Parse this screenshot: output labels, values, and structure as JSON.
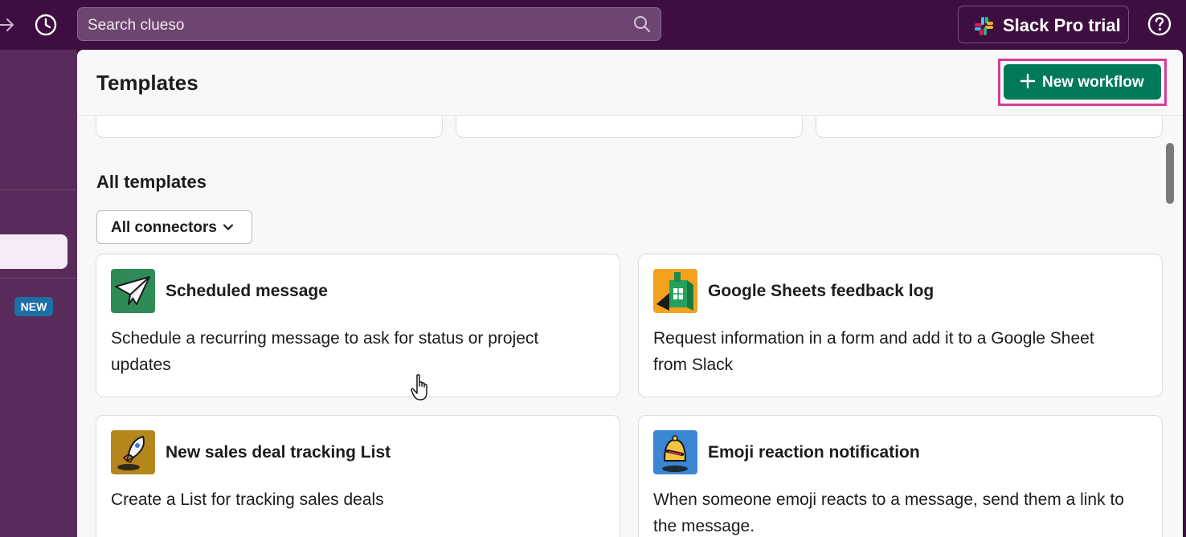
{
  "topbar": {
    "search_placeholder": "Search clueso",
    "pro_trial_label": "Slack Pro trial"
  },
  "sidebar": {
    "new_badge": "NEW"
  },
  "panel": {
    "title": "Templates",
    "new_workflow_label": "New workflow",
    "section_title": "All templates",
    "filter_label": "All connectors"
  },
  "templates": [
    {
      "title": "Scheduled message",
      "description": "Schedule a recurring message to ask for status or project updates",
      "icon": "paper-plane-icon"
    },
    {
      "title": "Google Sheets feedback log",
      "description": "Request information in a form and add it to a Google Sheet from Slack",
      "icon": "google-sheets-icon"
    },
    {
      "title": "New sales deal tracking List",
      "description": "Create a List for tracking sales deals",
      "icon": "rocket-icon"
    },
    {
      "title": "Emoji reaction notification",
      "description": "When someone emoji reacts to a message, send them a link to the message.",
      "icon": "bell-icon"
    }
  ],
  "colors": {
    "aubergine": "#3f0e40",
    "sidebar": "#592b5b",
    "primary_green": "#007a5a",
    "highlight_pink": "#d63d96",
    "new_badge_blue": "#1d6fa5"
  }
}
